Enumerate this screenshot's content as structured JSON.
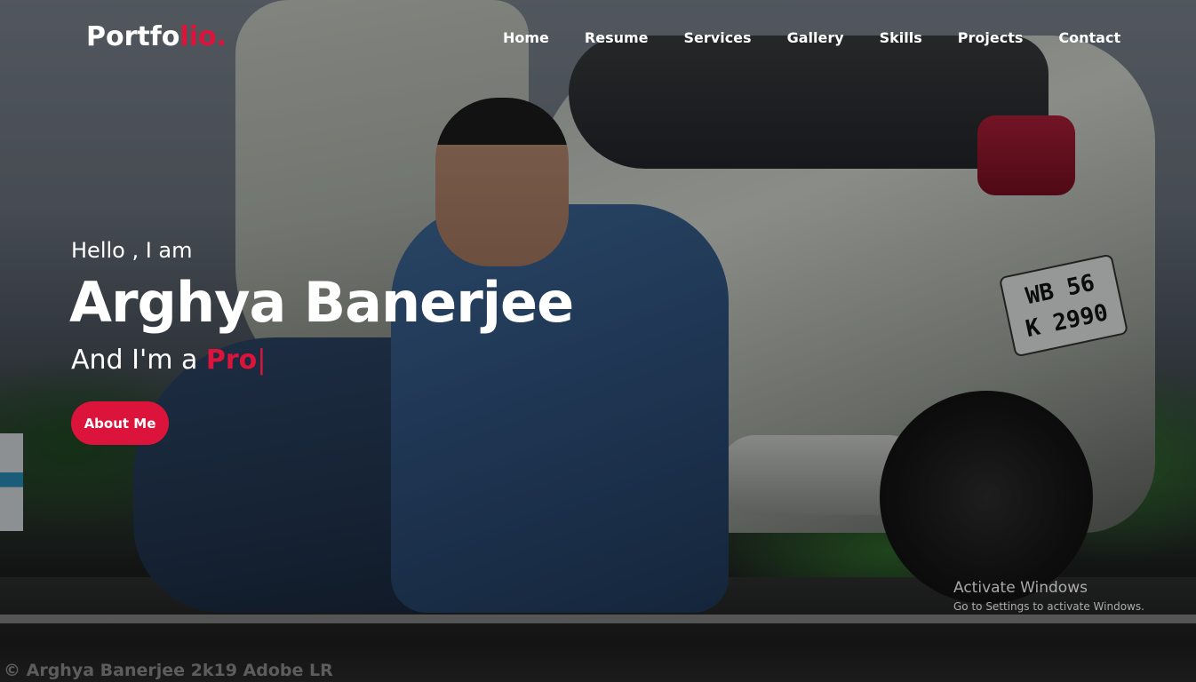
{
  "logo": {
    "text_main": "Portfo",
    "text_accent": "lio."
  },
  "nav": {
    "items": [
      "Home",
      "Resume",
      "Services",
      "Gallery",
      "Skills",
      "Projects",
      "Contact"
    ]
  },
  "hero": {
    "greeting": "Hello , I am",
    "name": "Arghya Banerjee",
    "role_prefix": "And I'm a ",
    "role_typed": "Pro",
    "cursor": "|",
    "button_label": "About Me"
  },
  "photo": {
    "plate_line1": "WB 56",
    "plate_line2": "K 2990",
    "watermark": "© Arghya Banerjee 2k19 Adobe LR"
  },
  "os_overlay": {
    "title": "Activate Windows",
    "subtitle": "Go to Settings to activate Windows."
  },
  "colors": {
    "accent": "#dc143c",
    "text": "#ffffff"
  }
}
